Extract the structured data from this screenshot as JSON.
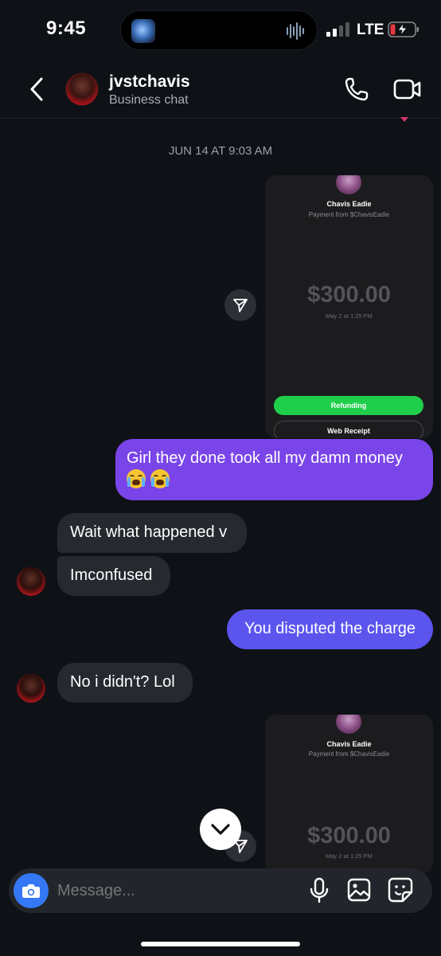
{
  "status_bar": {
    "time": "9:45",
    "network": "LTE"
  },
  "header": {
    "name": "jvstchavis",
    "subtitle": "Business chat",
    "icons": [
      "back-chevron-icon",
      "phone-icon",
      "video-icon"
    ]
  },
  "date_divider": "JUN 14 AT 9:03 AM",
  "receipt_cards": [
    {
      "name": "Chavis Eadie",
      "from": "Payment from $ChavisEadie",
      "amount": "$300.00",
      "date": "May 2 at 1:25 PM",
      "refund_label": "Refunding",
      "receipt_label": "Web Receipt"
    },
    {
      "name": "Chavis Eadie",
      "from": "Payment from $ChavisEadie",
      "amount": "$300.00",
      "date": "May 2 at 1:25 PM"
    }
  ],
  "messages": [
    {
      "direction": "outgoing",
      "text": "Girl they done took all my damn money",
      "emoji": "loudly-crying-face"
    },
    {
      "direction": "incoming",
      "text": "Wait what happened v"
    },
    {
      "direction": "incoming",
      "text": "Imconfused"
    },
    {
      "direction": "outgoing",
      "text": "You disputed the charge"
    },
    {
      "direction": "incoming",
      "text": "No i didn't? Lol"
    }
  ],
  "composer": {
    "placeholder": "Message...",
    "icons": [
      "camera-icon",
      "microphone-icon",
      "gallery-icon",
      "sticker-icon"
    ]
  },
  "colors": {
    "outgoing_bubble": "#7a45e8",
    "outgoing_bubble_2": "#5b55ee",
    "incoming_bubble": "#26292f",
    "camera_button": "#3478f6",
    "refund_button": "#1fcf4c",
    "background": "#0e1116"
  }
}
